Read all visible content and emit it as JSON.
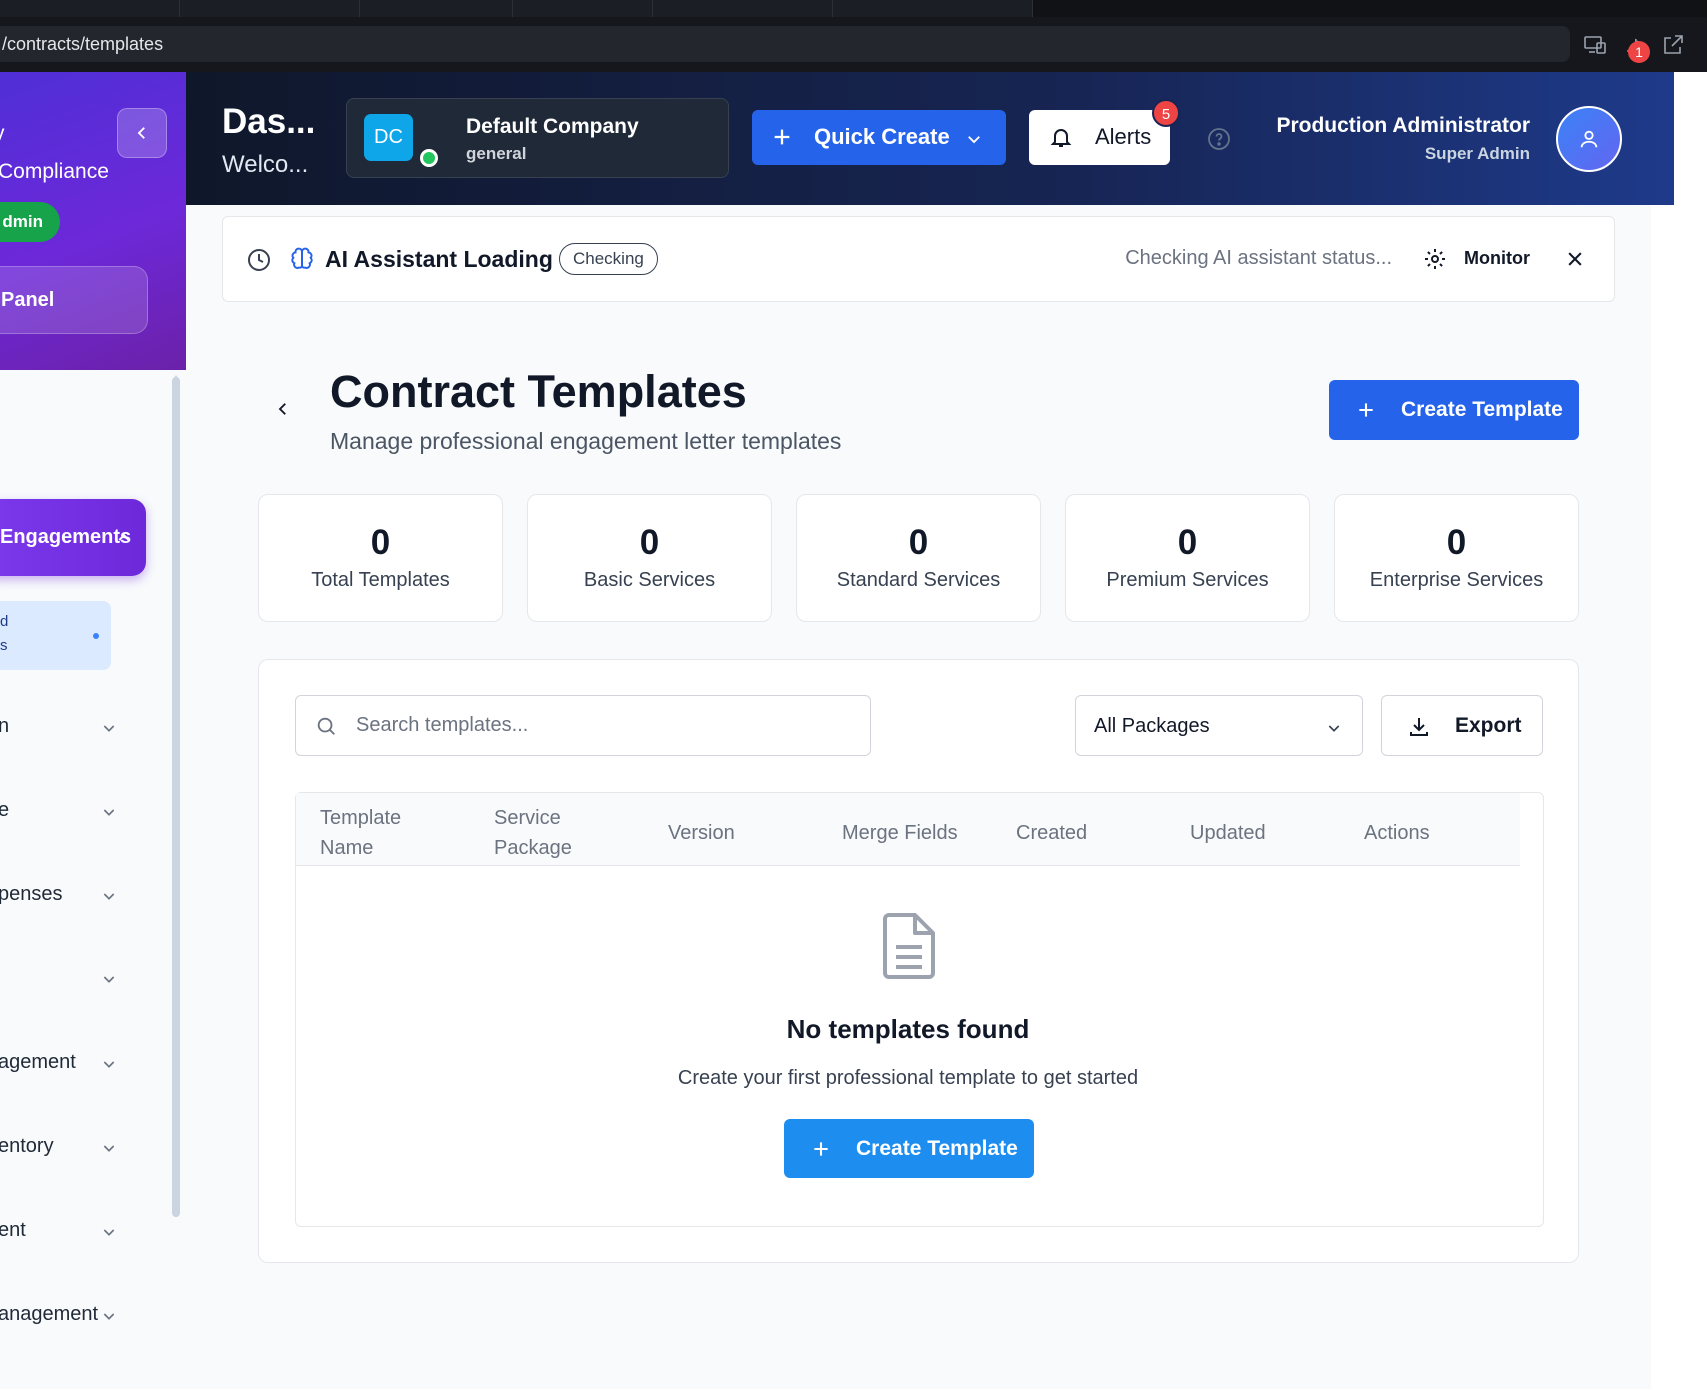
{
  "browser": {
    "url": "/contracts/templates",
    "extension_badge": "1"
  },
  "sidebar": {
    "title_line1": "y",
    "title_line2": "Compliance",
    "role_pill": "dmin",
    "panel_button": "Panel",
    "active_section": "Engagements",
    "active_sub_line1": "d",
    "active_sub_line2": "s",
    "items": [
      {
        "label": "n"
      },
      {
        "label": "e"
      },
      {
        "label": "penses"
      },
      {
        "label": ""
      },
      {
        "label": "agement"
      },
      {
        "label": "entory"
      },
      {
        "label": "ent"
      },
      {
        "label": "anagement"
      }
    ]
  },
  "header": {
    "title": "Das...",
    "subtitle": "Welco...",
    "company_initials": "DC",
    "company_name": "Default Company",
    "company_type": "general",
    "quick_create": "Quick Create",
    "alerts_label": "Alerts",
    "alerts_count": "5",
    "user_name": "Production Administrator",
    "user_role": "Super Admin"
  },
  "ai_bar": {
    "title": "AI Assistant Loading",
    "status_badge": "Checking",
    "status_text": "Checking AI assistant status...",
    "monitor_label": "Monitor"
  },
  "page": {
    "title": "Contract Templates",
    "subtitle": "Manage professional engagement letter templates",
    "create_button": "Create Template"
  },
  "stats": [
    {
      "value": "0",
      "label": "Total Templates"
    },
    {
      "value": "0",
      "label": "Basic Services"
    },
    {
      "value": "0",
      "label": "Standard Services"
    },
    {
      "value": "0",
      "label": "Premium Services"
    },
    {
      "value": "0",
      "label": "Enterprise Services"
    }
  ],
  "filters": {
    "search_placeholder": "Search templates...",
    "package_selected": "All Packages",
    "export_label": "Export"
  },
  "table": {
    "columns": [
      {
        "line1": "Template",
        "line2": "Name"
      },
      {
        "line1": "Service",
        "line2": "Package"
      },
      {
        "line1": "Version",
        "line2": ""
      },
      {
        "line1": "Merge Fields",
        "line2": ""
      },
      {
        "line1": "Created",
        "line2": ""
      },
      {
        "line1": "Updated",
        "line2": ""
      },
      {
        "line1": "Actions",
        "line2": ""
      }
    ],
    "empty_title": "No templates found",
    "empty_subtitle": "Create your first professional template to get started",
    "empty_button": "Create Template"
  }
}
